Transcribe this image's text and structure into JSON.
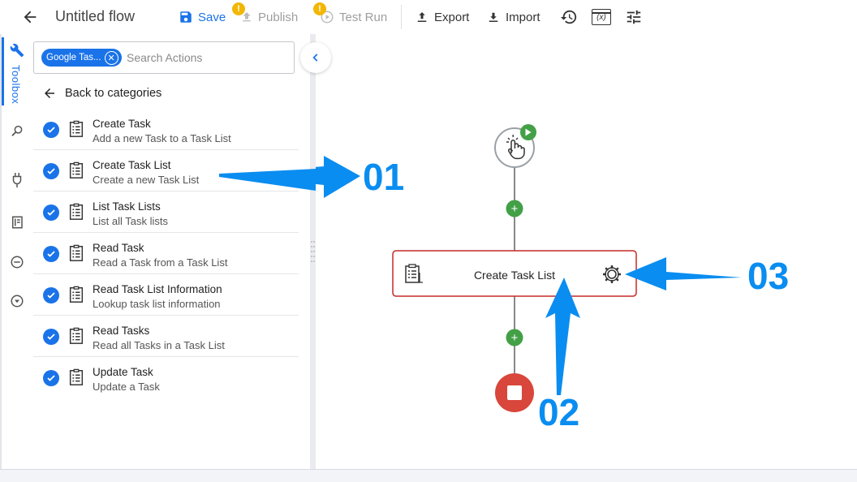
{
  "header": {
    "title": "Untitled flow",
    "save_label": "Save",
    "publish_label": "Publish",
    "testrun_label": "Test Run",
    "export_label": "Export",
    "import_label": "Import",
    "warning_badge": "!",
    "fx_label": "(x)"
  },
  "sidebar": {
    "toolbox_label": "Toolbox",
    "rail_icons": [
      "toolbox-icon",
      "search-icon",
      "plug-icon",
      "book-icon",
      "minus-circle-icon",
      "chevron-down-circle-icon"
    ]
  },
  "panel": {
    "chip_label": "Google Tas...",
    "search_placeholder": "Search Actions",
    "back_label": "Back to categories",
    "actions": [
      {
        "title": "Create Task",
        "desc": "Add a new Task to a Task List"
      },
      {
        "title": "Create Task List",
        "desc": "Create a new Task List"
      },
      {
        "title": "List Task Lists",
        "desc": "List all Task lists"
      },
      {
        "title": "Read Task",
        "desc": "Read a Task from a Task List"
      },
      {
        "title": "Read Task List Information",
        "desc": "Lookup task list information"
      },
      {
        "title": "Read Tasks",
        "desc": "Read all Tasks in a Task List"
      },
      {
        "title": "Update Task",
        "desc": "Update a Task"
      }
    ]
  },
  "canvas": {
    "node_label": "Create Task List",
    "plus": "+",
    "annotations": [
      "01",
      "02",
      "03"
    ]
  },
  "colors": {
    "accent": "#1a73e8",
    "warning": "#f2b705",
    "green": "#43a047",
    "stop_red": "#d9463b",
    "node_border": "#c62828",
    "annotation_blue": "#0a8df0"
  }
}
